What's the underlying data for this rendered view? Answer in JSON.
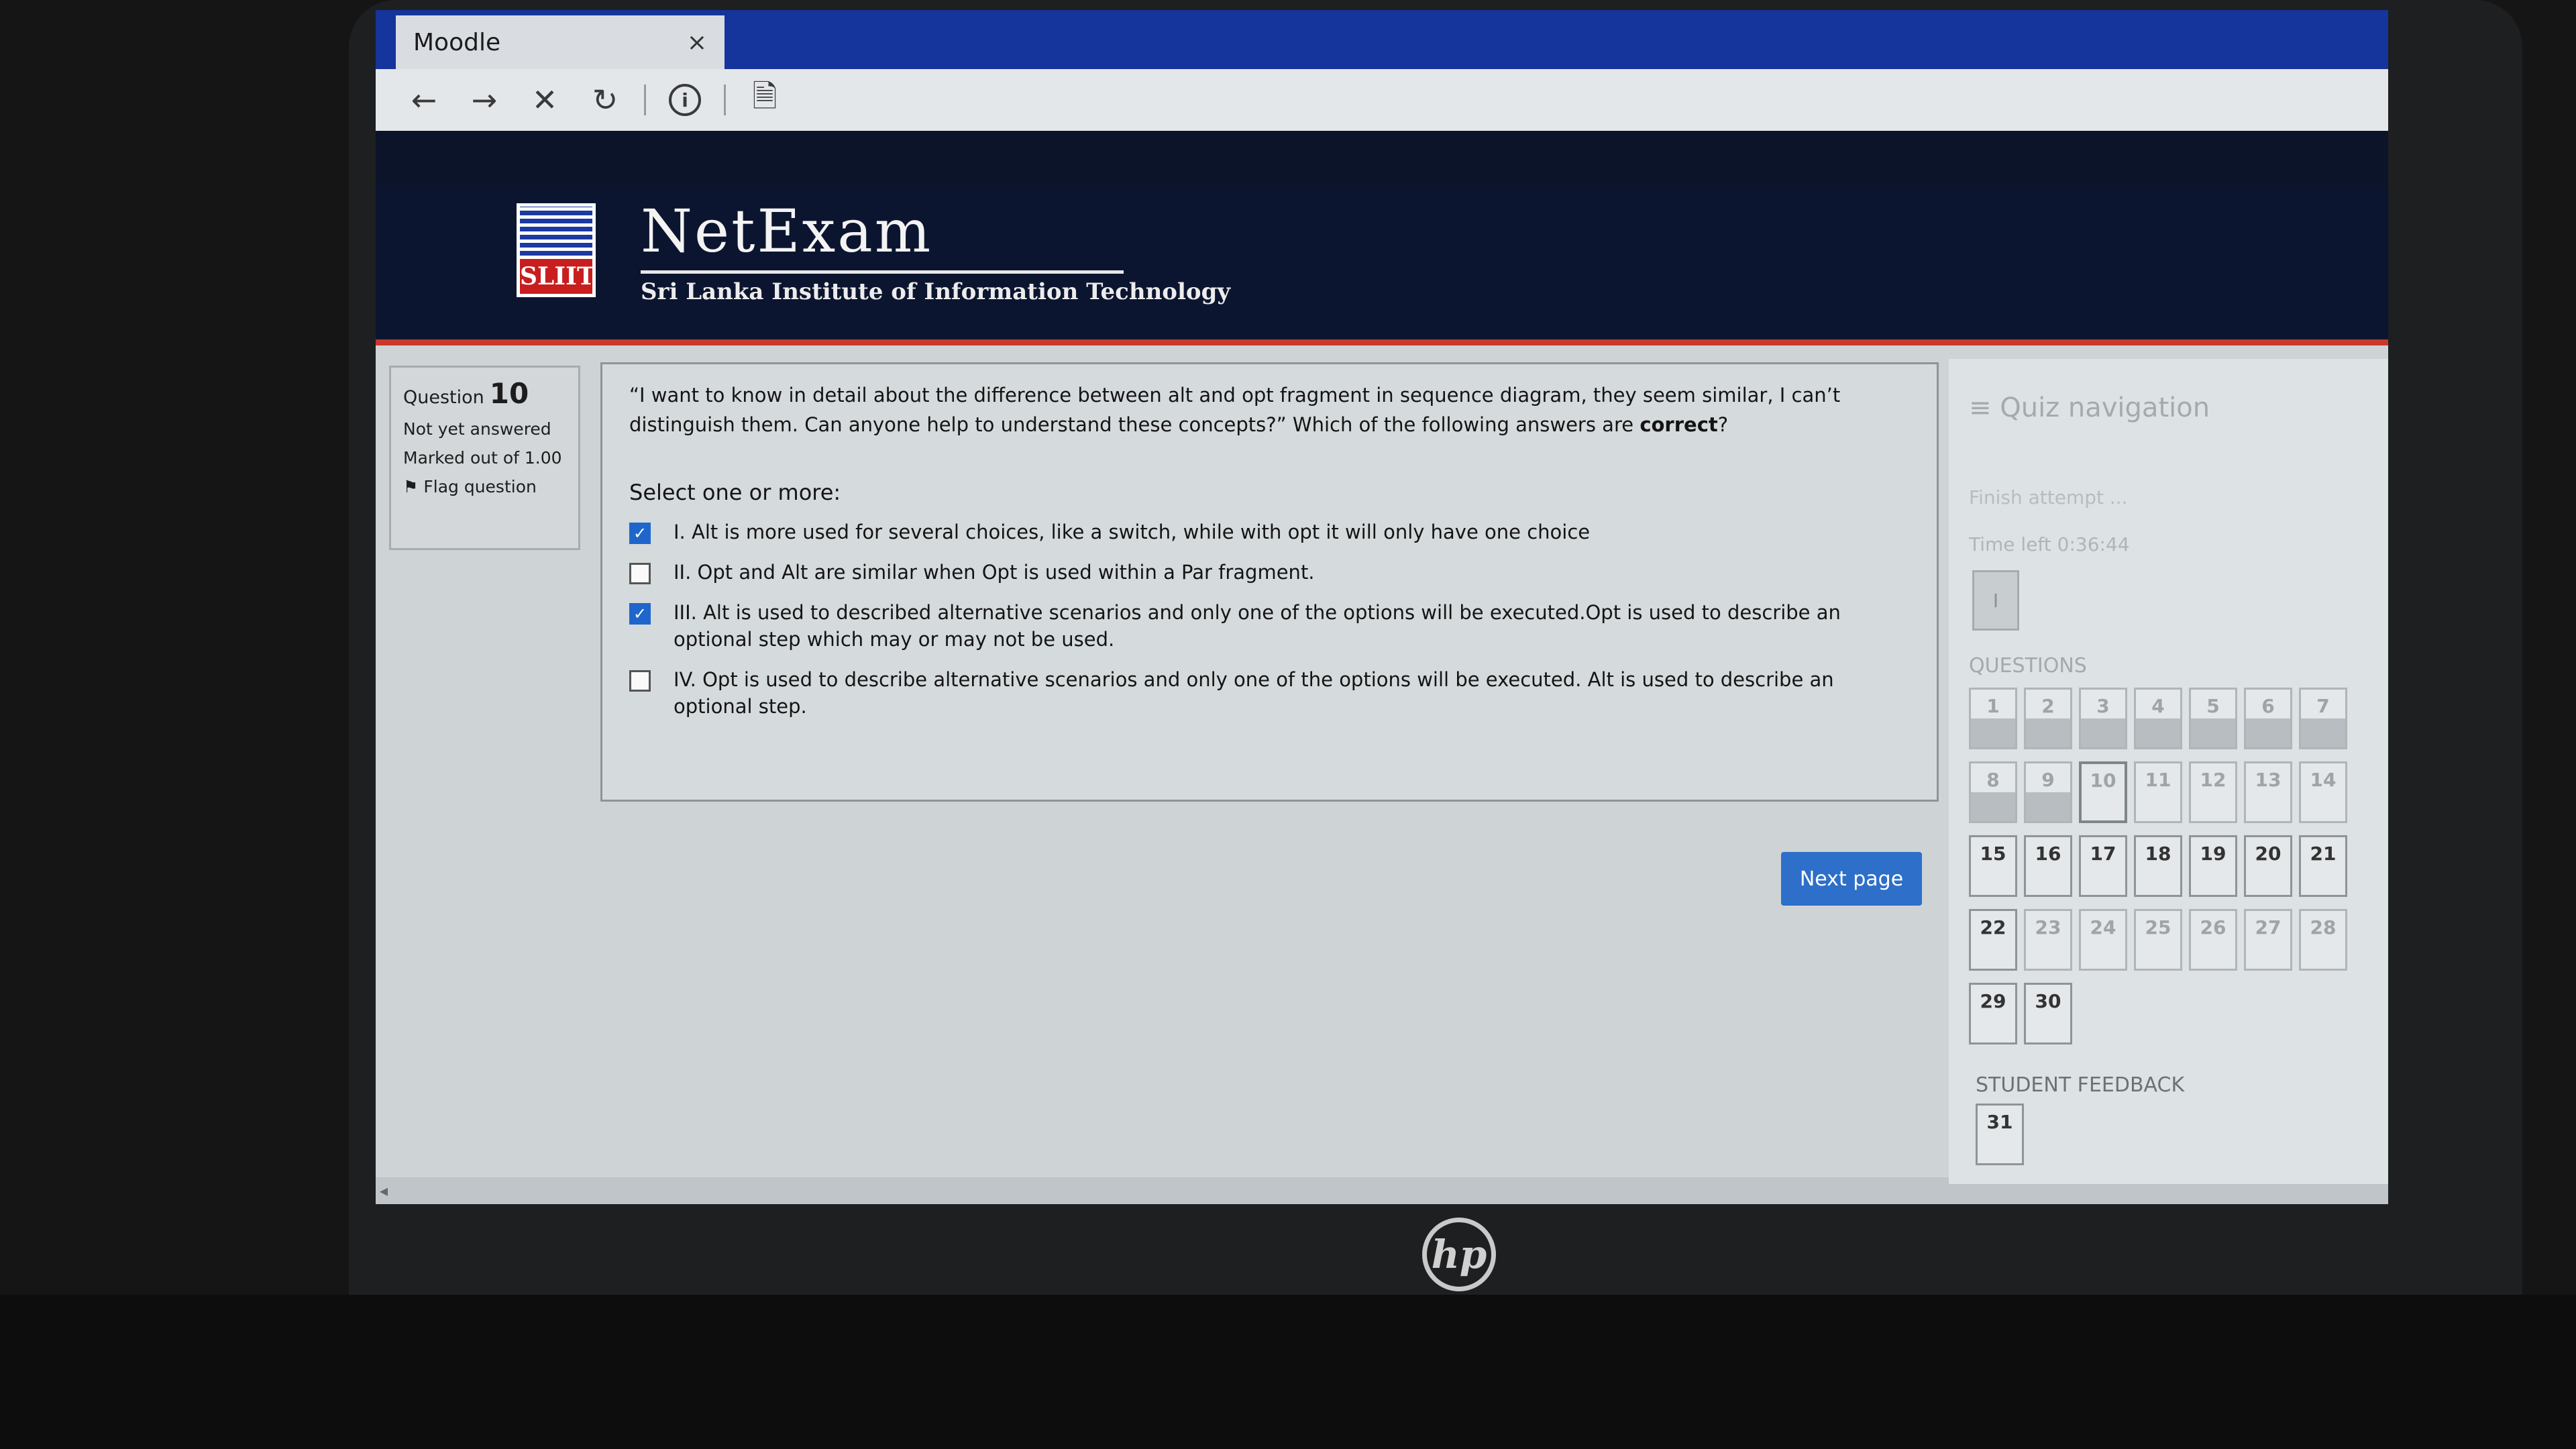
{
  "browser": {
    "tab_title": "Moodle",
    "tab_close": "×",
    "nav": {
      "back": "←",
      "forward": "→",
      "stop": "✕",
      "reload": "↻",
      "info": "i",
      "page": "🗎"
    }
  },
  "header": {
    "logo_text": "SLIIT",
    "brand_name": "NetExam",
    "subtitle": "Sri Lanka Institute of Information Technology"
  },
  "question_info": {
    "label": "Question",
    "number": "10",
    "status": "Not yet answered",
    "marks": "Marked out of 1.00",
    "flag_icon": "⚑",
    "flag_label": "Flag question"
  },
  "question": {
    "text_before": "“I want to know in detail about the difference between alt and opt fragment in sequence diagram, they seem similar, I can’t distinguish them. Can anyone help to understand these concepts?” Which of the following answers are ",
    "text_emph": "correct",
    "text_after": "?",
    "prompt": "Select one or more:",
    "options": [
      {
        "label": "I. Alt is more used for several choices, like a switch, while with opt it will only have one choice",
        "checked": true
      },
      {
        "label": "II. Opt and Alt are similar when Opt is used within a Par fragment.",
        "checked": false
      },
      {
        "label": "III. Alt is used to described alternative scenarios and only one of the options will be executed.Opt is used to describe an optional step which may or may not be used.",
        "checked": true
      },
      {
        "label": "IV. Opt is used to describe alternative scenarios and only one of the options will be executed. Alt is used to describe an optional step.",
        "checked": false
      }
    ],
    "next_button": "Next page"
  },
  "quiz_nav": {
    "title": "≡ Quiz navigation",
    "finish": "Finish attempt ...",
    "time_left": "Time left 0:36:44",
    "user_pic": "I",
    "questions_heading": "QUESTIONS",
    "questions": [
      {
        "n": "1",
        "answered": true
      },
      {
        "n": "2",
        "answered": true
      },
      {
        "n": "3",
        "answered": true
      },
      {
        "n": "4",
        "answered": true
      },
      {
        "n": "5",
        "answered": true
      },
      {
        "n": "6",
        "answered": true
      },
      {
        "n": "7",
        "answered": true
      },
      {
        "n": "8",
        "answered": true
      },
      {
        "n": "9",
        "answered": true
      },
      {
        "n": "10",
        "answered": false
      },
      {
        "n": "11",
        "answered": false
      },
      {
        "n": "12",
        "answered": false
      },
      {
        "n": "13",
        "answered": false
      },
      {
        "n": "14",
        "answered": false
      },
      {
        "n": "15",
        "answered": false
      },
      {
        "n": "16",
        "answered": false
      },
      {
        "n": "17",
        "answered": false
      },
      {
        "n": "18",
        "answered": false
      },
      {
        "n": "19",
        "answered": false
      },
      {
        "n": "20",
        "answered": false
      },
      {
        "n": "21",
        "answered": false
      },
      {
        "n": "22",
        "answered": false
      },
      {
        "n": "23",
        "answered": false
      },
      {
        "n": "24",
        "answered": false
      },
      {
        "n": "25",
        "answered": false
      },
      {
        "n": "26",
        "answered": false
      },
      {
        "n": "27",
        "answered": false
      },
      {
        "n": "28",
        "answered": false
      },
      {
        "n": "29",
        "answered": false
      },
      {
        "n": "30",
        "answered": false
      }
    ],
    "current": "10",
    "feedback_heading": "STUDENT FEEDBACK",
    "feedback_question": "31"
  },
  "laptop": {
    "logo": "hp"
  }
}
